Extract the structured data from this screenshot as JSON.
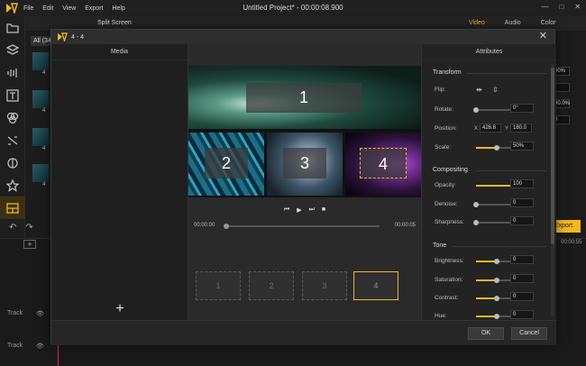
{
  "app": {
    "title": "Untitled Project* - 00:00:08.900",
    "menu": [
      "File",
      "Edit",
      "View",
      "Export",
      "Help"
    ],
    "window_controls": [
      "—",
      "□",
      "✕"
    ],
    "left_panel_header": "Split Screen",
    "right_tabs": [
      "Video",
      "Audio",
      "Color"
    ],
    "media_filter": "All (34",
    "thumb_numbers": [
      "4",
      "4",
      "4",
      "4",
      "4"
    ],
    "right_fields": [
      "00%",
      "°",
      "00.0%",
      "0"
    ],
    "export_label": "Export",
    "timecode": "00:00:55",
    "tracks": [
      {
        "label": "Track",
        "eye": "👁"
      },
      {
        "label": "Track",
        "eye": "👁"
      }
    ],
    "add_track": "+",
    "accent": "#f0b81c"
  },
  "dialog": {
    "title": "4 - 4",
    "close": "✕",
    "media": {
      "header": "Media",
      "add": "+"
    },
    "preview": {
      "cells": [
        "1",
        "2",
        "3",
        "4"
      ],
      "selected_cell": "4"
    },
    "player": {
      "prev": "⏮",
      "play": "▶",
      "next": "⏭",
      "stop": "■",
      "current_time": "00:00:00",
      "total_time": "00:00:05",
      "progress": 0.0
    },
    "layout_slots": [
      "1",
      "2",
      "3",
      "4"
    ],
    "attributes": {
      "header": "Attributes",
      "transform": {
        "title": "Transform",
        "flip_label": "Flip:",
        "rotate_label": "Rotate:",
        "rotate_value": "0°",
        "rotate_level": 0.0,
        "position_label": "Position:",
        "x_label": "X",
        "x_value": "426.8",
        "y_label": "Y",
        "y_value": "180.0",
        "scale_label": "Scale:",
        "scale_value": "50%",
        "scale_level": 0.5
      },
      "compositing": {
        "title": "Compositing",
        "opacity_label": "Opacity:",
        "opacity_value": "100",
        "opacity_level": 1.0,
        "denoise_label": "Denoise:",
        "denoise_value": "0",
        "denoise_level": 0.0,
        "sharpness_label": "Sharpness:",
        "sharpness_value": "0",
        "sharpness_level": 0.0
      },
      "tone": {
        "title": "Tone",
        "brightness_label": "Brightness:",
        "brightness_value": "0",
        "saturation_label": "Saturation:",
        "saturation_value": "0",
        "contrast_label": "Contrast:",
        "contrast_value": "0",
        "hue_label": "Hue:",
        "hue_value": "0",
        "level": 0.5
      }
    },
    "ok_label": "OK",
    "cancel_label": "Cancel"
  }
}
